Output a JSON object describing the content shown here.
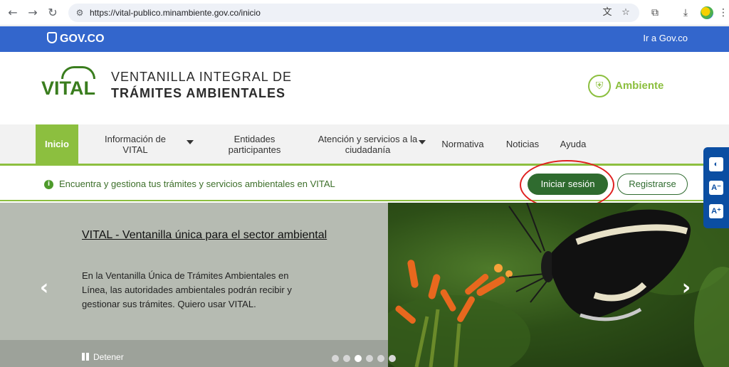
{
  "browser": {
    "url": "https://vital-publico.minambiente.gov.co/inicio"
  },
  "govbar": {
    "logo_text": "GOV.CO",
    "link": "Ir a Gov.co"
  },
  "header": {
    "logo_word": "VITAL",
    "title_line1": "VENTANILLA INTEGRAL DE",
    "title_line2": "TRÁMITES AMBIENTALES",
    "ministry": "Ambiente"
  },
  "nav": {
    "items": [
      {
        "label": "Inicio"
      },
      {
        "label": "Información de VITAL"
      },
      {
        "label": "Entidades participantes"
      },
      {
        "label": "Atención y servicios a la ciudadanía"
      },
      {
        "label": "Normativa"
      },
      {
        "label": "Noticias"
      },
      {
        "label": "Ayuda"
      }
    ]
  },
  "info": {
    "text": "Encuentra y gestiona tus trámites y servicios ambientales en VITAL",
    "login_label": "Iniciar sesión",
    "register_label": "Registrarse"
  },
  "carousel": {
    "title": "VITAL - Ventanilla única para el sector ambiental",
    "body": "En la Ventanilla Única de Trámites Ambientales en Línea, las autoridades ambientales podrán recibir y gestionar sus trámites. Quiero usar VITAL.",
    "stop_label": "Detener",
    "prev_glyph": "‹",
    "next_glyph": "›",
    "slide_count": 6,
    "active_slide": 3
  },
  "accessibility": {
    "contrast_glyph": "◐",
    "decrease_glyph": "A⁻",
    "increase_glyph": "A⁺"
  },
  "colors": {
    "gov_blue": "#3366cc",
    "vital_green": "#3a7d1e",
    "accent_green": "#8cbf3f",
    "button_green": "#2f6b2f",
    "annotation_red": "#e02020"
  }
}
